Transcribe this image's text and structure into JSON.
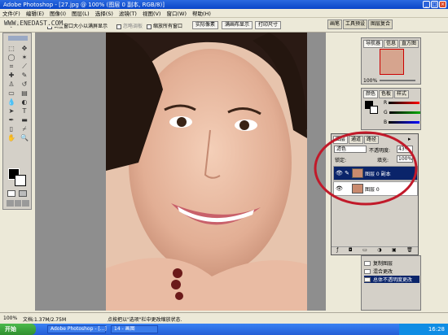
{
  "title_bar": {
    "text": "Adobe Photoshop - [27.jpg @ 100% (图层 0 副本, RGB/8)]"
  },
  "watermark": "WWW.ENEDAST.COM",
  "menu": [
    "文件(F)",
    "编辑(E)",
    "图像(I)",
    "图层(L)",
    "选择(S)",
    "滤镜(T)",
    "视图(V)",
    "窗口(W)",
    "帮助(H)"
  ],
  "options": {
    "resize_windows": "调整窗口大小以满屏显示",
    "ignore_palettes": "忽略调板",
    "zoom_all": "缩放所有窗口",
    "actual_pixels": "实际像素",
    "fit_screen": "满画布显示",
    "print_size": "打印尺寸"
  },
  "dock_tabs": [
    "画笔",
    "工具预设",
    "图层复合"
  ],
  "navigator": {
    "tabs": [
      "导航器",
      "信息",
      "直方图"
    ],
    "zoom": "100%"
  },
  "color_panel": {
    "tabs": [
      "颜色",
      "色板",
      "样式"
    ],
    "channels": [
      "R",
      "G",
      "B"
    ],
    "values": [
      0,
      0,
      0
    ]
  },
  "layers": {
    "tabs": [
      "图层",
      "通道",
      "路径"
    ],
    "blend_mode": "滤色",
    "opacity_label": "不透明度:",
    "opacity": "43%",
    "lock_label": "锁定:",
    "fill_label": "填充:",
    "fill": "100%",
    "items": [
      {
        "name": "图层 0 副本",
        "selected": true
      },
      {
        "name": "图层 0",
        "selected": false
      }
    ]
  },
  "history": {
    "items": [
      "复制图层",
      "混合更改",
      "总体不透明度更改"
    ]
  },
  "status": {
    "zoom": "100%",
    "doc": "文档:1.37M/2.75M",
    "tip": "点按把以\"选项\"栏中更改缩放状态."
  },
  "taskbar": {
    "start": "开始",
    "tasks": [
      "Adobe Photoshop - [...]",
      "14 - 画图"
    ],
    "clock": "16:28"
  }
}
